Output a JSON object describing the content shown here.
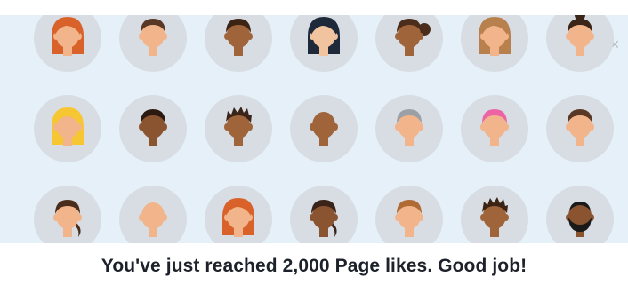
{
  "notification": {
    "message": "You've just reached 2,000 Page likes. Good job!",
    "close_glyph": "×"
  },
  "avatars": [
    {
      "name": "avatar-red-hair-woman",
      "skin": "#f2b48a",
      "hair": "#d9622b",
      "style": "long"
    },
    {
      "name": "avatar-short-hair-man",
      "skin": "#f2b48a",
      "hair": "#5a3826",
      "style": "short"
    },
    {
      "name": "avatar-dark-skin-man",
      "skin": "#a0643b",
      "hair": "#3c2415",
      "style": "short"
    },
    {
      "name": "avatar-black-hair-woman",
      "skin": "#f2c39f",
      "hair": "#1e2a3a",
      "style": "long"
    },
    {
      "name": "avatar-curly-hair-woman",
      "skin": "#a0643b",
      "hair": "#4a2d1a",
      "style": "bun-side"
    },
    {
      "name": "avatar-brown-hair-woman",
      "skin": "#f2b48a",
      "hair": "#b7804c",
      "style": "long"
    },
    {
      "name": "avatar-bun-hair-woman",
      "skin": "#f2b48a",
      "hair": "#3a2518",
      "style": "bun-top"
    },
    {
      "name": "avatar-blonde-woman",
      "skin": "#f2b48a",
      "hair": "#f6c633",
      "style": "long"
    },
    {
      "name": "avatar-dark-skin-man-2",
      "skin": "#8a5431",
      "hair": "#2c1a10",
      "style": "short"
    },
    {
      "name": "avatar-spiky-hair-man",
      "skin": "#a0643b",
      "hair": "#3a2318",
      "style": "spiky"
    },
    {
      "name": "avatar-bald-man",
      "skin": "#a0643b",
      "hair": "#a0643b",
      "style": "bald"
    },
    {
      "name": "avatar-gray-hair-man",
      "skin": "#f2b48a",
      "hair": "#9aa0a6",
      "style": "short"
    },
    {
      "name": "avatar-pink-hair-woman",
      "skin": "#f2b48a",
      "hair": "#ec64a6",
      "style": "short"
    },
    {
      "name": "avatar-brown-hair-man",
      "skin": "#f2b48a",
      "hair": "#5a3826",
      "style": "short"
    },
    {
      "name": "avatar-ponytail-woman",
      "skin": "#f2b48a",
      "hair": "#4a2d1a",
      "style": "side"
    },
    {
      "name": "avatar-balding-man",
      "skin": "#f2b48a",
      "hair": "#e0a07a",
      "style": "bald"
    },
    {
      "name": "avatar-red-hair-woman-2",
      "skin": "#f2b48a",
      "hair": "#d9622b",
      "style": "long"
    },
    {
      "name": "avatar-dark-man-3",
      "skin": "#8a5431",
      "hair": "#3a2318",
      "style": "side"
    },
    {
      "name": "avatar-auburn-hair-woman",
      "skin": "#f2b48a",
      "hair": "#b06a34",
      "style": "short"
    },
    {
      "name": "avatar-spiky-man-2",
      "skin": "#a0643b",
      "hair": "#3c2415",
      "style": "spiky"
    },
    {
      "name": "avatar-bearded-man",
      "skin": "#8a5431",
      "hair": "#1a1a1a",
      "style": "beard"
    }
  ]
}
